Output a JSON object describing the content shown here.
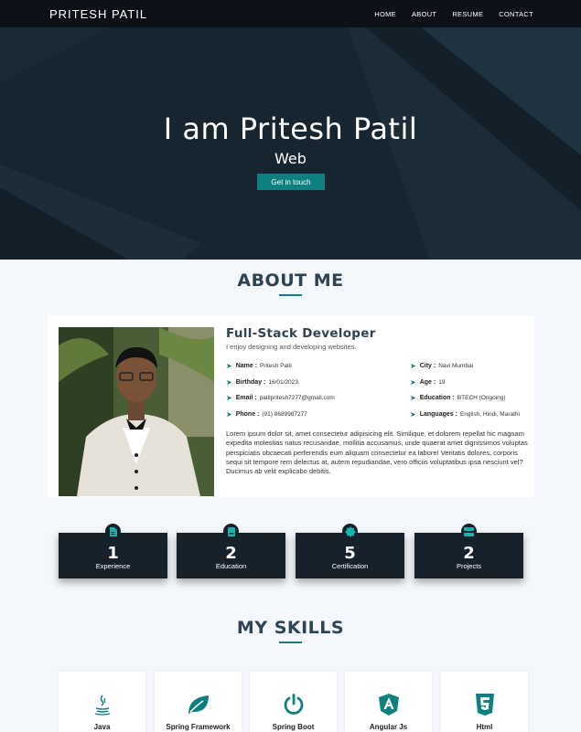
{
  "nav": {
    "brand": "PRITESH  PATIL",
    "links": [
      "HOME",
      "ABOUT",
      "RESUME",
      "CONTACT"
    ]
  },
  "hero": {
    "title": "I am Pritesh Patil",
    "subtitle": "Web",
    "button": "Get in touch"
  },
  "about": {
    "heading": "ABOUT ME",
    "role": "Full-Stack Developer",
    "tagline": "I enjoy designing and developing websites.",
    "info_left": [
      {
        "label": "Name :",
        "value": "Pritesh Patil"
      },
      {
        "label": "Birthday :",
        "value": "16/01/2023"
      },
      {
        "label": "Email :",
        "value": "patilpritesh7277@gmail.com"
      },
      {
        "label": "Phone :",
        "value": "(91) 8689987277"
      }
    ],
    "info_right": [
      {
        "label": "City :",
        "value": "Navi Mumbai"
      },
      {
        "label": "Age :",
        "value": "19"
      },
      {
        "label": "Education :",
        "value": "BTECH (Ongoing)"
      },
      {
        "label": "Languages :",
        "value": "English, Hindi, Marathi"
      }
    ],
    "paragraph": "Lorem ipsum dolor sit, amet consectetur adipisicing elit. Similique, et dolorem repellat hic magnam expedita molestias natus recusandae, mollitia accusamus, unde quaerat amet dignissimos voluptas perspiciatis obcaecati perferendis eum aliquam consectetur ea labore! Veritatis dolores, corporis sequi sit tempore rem delectus at, autem repudiandae, vero officiis voluptatibus ipsa nesciunt vel? Ducimus ab velit explicabo debitis."
  },
  "stats": [
    {
      "number": "1",
      "label": "Experience",
      "icon": "file-icon"
    },
    {
      "number": "2",
      "label": "Education",
      "icon": "book-icon"
    },
    {
      "number": "5",
      "label": "Certification",
      "icon": "certificate-badge-icon"
    },
    {
      "number": "2",
      "label": "Projects",
      "icon": "server-icon"
    }
  ],
  "skills": {
    "heading": "MY SKILLS",
    "items": [
      {
        "name": "Java",
        "icon": "java-icon"
      },
      {
        "name": "Spring Framework",
        "icon": "spring-leaf-icon"
      },
      {
        "name": "Spring Boot",
        "icon": "power-icon"
      },
      {
        "name": "Angular Js",
        "icon": "angular-icon"
      },
      {
        "name": "Html",
        "icon": "html5-icon"
      }
    ]
  },
  "colors": {
    "accent": "#0f8080",
    "nav_bg": "#0b1117",
    "hero_bg": "#162530",
    "stat_bg": "#17212b",
    "page_bg": "#f4f7fb",
    "heading": "#2d4356"
  }
}
